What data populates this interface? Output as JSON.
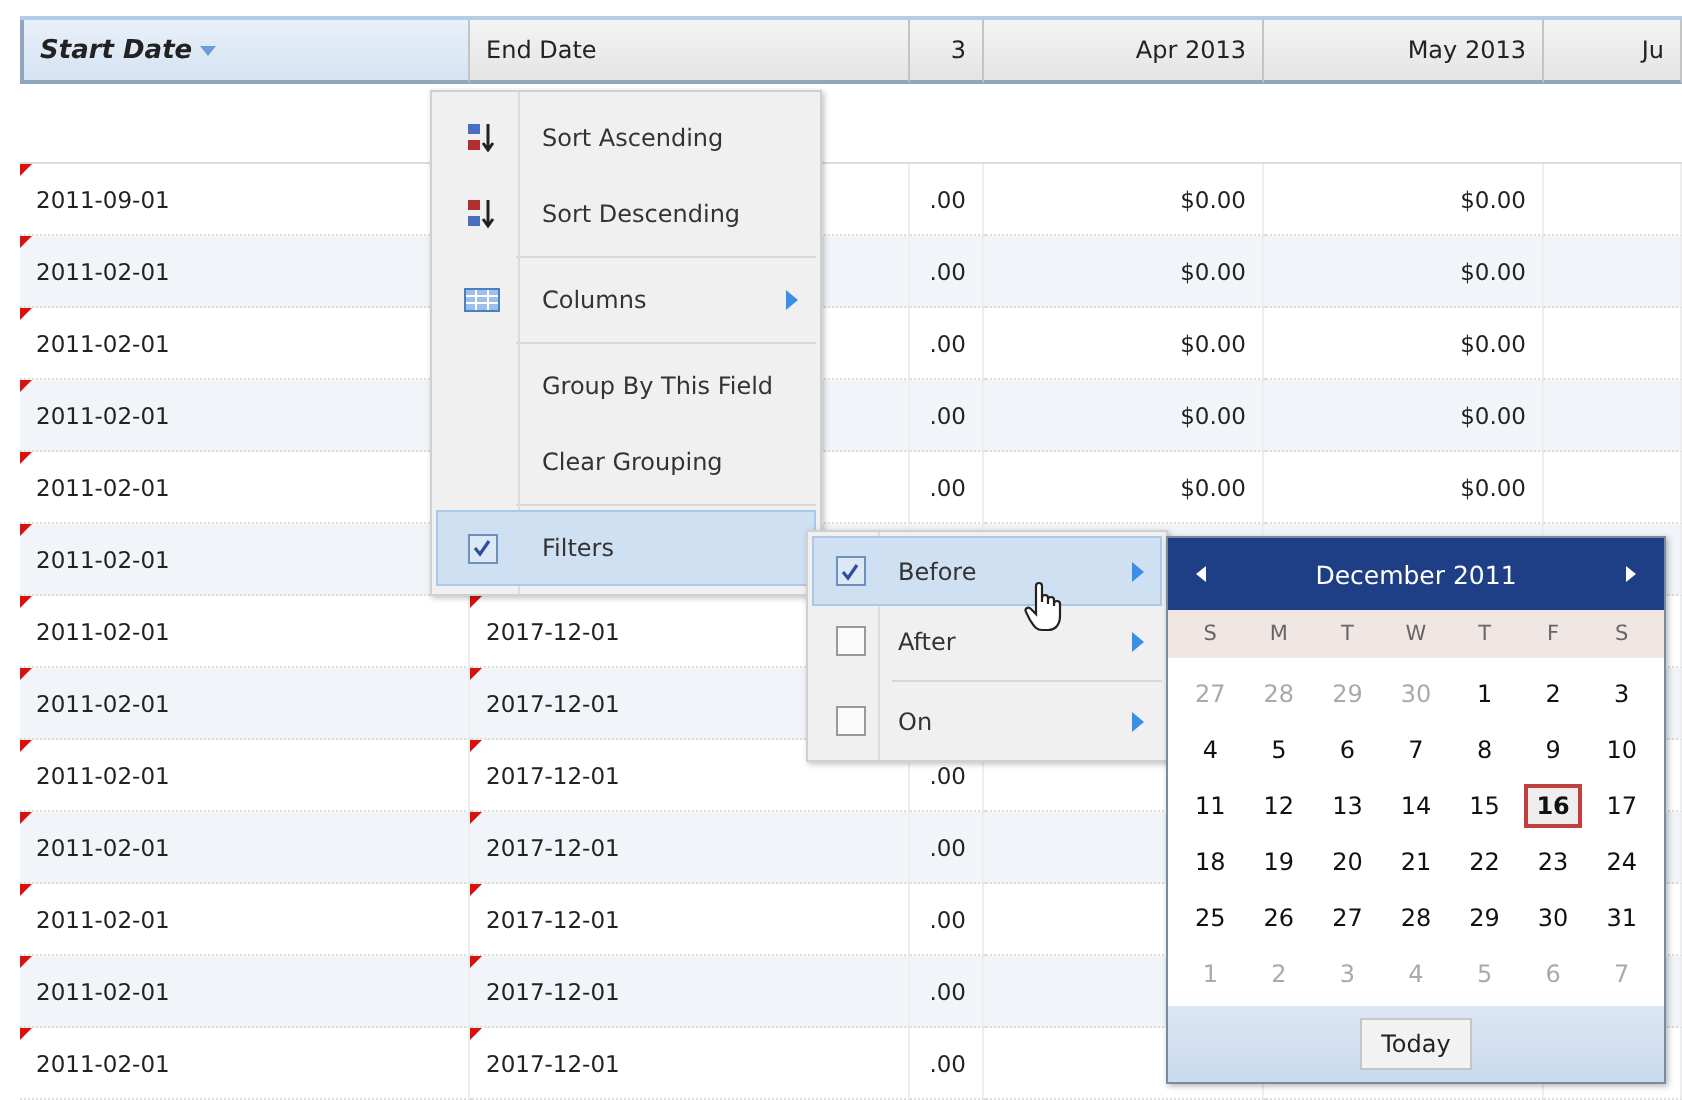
{
  "table": {
    "columns": [
      {
        "label": "Start Date",
        "active": true
      },
      {
        "label": "End Date",
        "active": false
      },
      {
        "label": "3",
        "active": false
      },
      {
        "label": "Apr 2013",
        "active": false
      },
      {
        "label": "May 2013",
        "active": false
      },
      {
        "label": "Ju",
        "active": false
      }
    ],
    "rows": [
      {
        "cells": [
          {
            "text": "2011-09-01",
            "modified": true
          },
          {
            "text": "",
            "modified": false
          },
          {
            "text": ".00",
            "modified": false
          },
          {
            "text": "$0.00",
            "modified": false
          },
          {
            "text": "$0.00",
            "modified": false
          },
          {
            "text": "",
            "modified": false
          }
        ]
      },
      {
        "cells": [
          {
            "text": "2011-02-01",
            "modified": true
          },
          {
            "text": "",
            "modified": false
          },
          {
            "text": ".00",
            "modified": false
          },
          {
            "text": "$0.00",
            "modified": false
          },
          {
            "text": "$0.00",
            "modified": false
          },
          {
            "text": "",
            "modified": false
          }
        ]
      },
      {
        "cells": [
          {
            "text": "2011-02-01",
            "modified": true
          },
          {
            "text": "",
            "modified": false
          },
          {
            "text": ".00",
            "modified": false
          },
          {
            "text": "$0.00",
            "modified": false
          },
          {
            "text": "$0.00",
            "modified": false
          },
          {
            "text": "",
            "modified": false
          }
        ]
      },
      {
        "cells": [
          {
            "text": "2011-02-01",
            "modified": true
          },
          {
            "text": "",
            "modified": false
          },
          {
            "text": ".00",
            "modified": false
          },
          {
            "text": "$0.00",
            "modified": false
          },
          {
            "text": "$0.00",
            "modified": false
          },
          {
            "text": "",
            "modified": false
          }
        ]
      },
      {
        "cells": [
          {
            "text": "2011-02-01",
            "modified": true
          },
          {
            "text": "",
            "modified": false
          },
          {
            "text": ".00",
            "modified": false
          },
          {
            "text": "$0.00",
            "modified": false
          },
          {
            "text": "$0.00",
            "modified": false
          },
          {
            "text": "",
            "modified": false
          }
        ]
      },
      {
        "cells": [
          {
            "text": "2011-02-01",
            "modified": true
          },
          null,
          null,
          {
            "text": "",
            "modified": false
          },
          {
            "text": "",
            "modified": false
          },
          {
            "text": "",
            "modified": false
          }
        ]
      },
      {
        "cells": [
          {
            "text": "2011-02-01",
            "modified": true
          },
          {
            "text": "2017-12-01",
            "modified": true
          },
          null,
          null,
          null,
          {
            "text": "",
            "modified": false
          }
        ]
      },
      {
        "cells": [
          {
            "text": "2011-02-01",
            "modified": true
          },
          {
            "text": "2017-12-01",
            "modified": true
          },
          null,
          null,
          null,
          {
            "text": "",
            "modified": false
          }
        ]
      },
      {
        "cells": [
          {
            "text": "2011-02-01",
            "modified": true
          },
          {
            "text": "2017-12-01",
            "modified": true
          },
          {
            "text": ".00",
            "modified": false
          },
          null,
          null,
          {
            "text": "",
            "modified": false
          }
        ]
      },
      {
        "cells": [
          {
            "text": "2011-02-01",
            "modified": true
          },
          {
            "text": "2017-12-01",
            "modified": true
          },
          {
            "text": ".00",
            "modified": false
          },
          {
            "text": "",
            "modified": false
          },
          null,
          {
            "text": "",
            "modified": false
          }
        ]
      },
      {
        "cells": [
          {
            "text": "2011-02-01",
            "modified": true
          },
          {
            "text": "2017-12-01",
            "modified": true
          },
          {
            "text": ".00",
            "modified": false
          },
          {
            "text": "",
            "modified": false
          },
          null,
          {
            "text": "",
            "modified": false
          }
        ]
      },
      {
        "cells": [
          {
            "text": "2011-02-01",
            "modified": true
          },
          {
            "text": "2017-12-01",
            "modified": true
          },
          {
            "text": ".00",
            "modified": false
          },
          {
            "text": "",
            "modified": false
          },
          null,
          {
            "text": "",
            "modified": false
          }
        ]
      },
      {
        "cells": [
          {
            "text": "2011-02-01",
            "modified": true
          },
          {
            "text": "2017-12-01",
            "modified": true
          },
          {
            "text": ".00",
            "modified": false
          },
          {
            "text": "",
            "modified": false
          },
          {
            "text": "",
            "modified": false
          },
          {
            "text": "",
            "modified": false
          }
        ]
      }
    ]
  },
  "column_menu": {
    "items": [
      {
        "kind": "sort-asc",
        "label": "Sort Ascending",
        "selected": false
      },
      {
        "kind": "sort-desc",
        "label": "Sort Descending",
        "selected": false
      },
      {
        "kind": "separator"
      },
      {
        "kind": "columns",
        "label": "Columns",
        "selected": false
      },
      {
        "kind": "separator"
      },
      {
        "kind": "plain",
        "label": "Group By This Field",
        "selected": false
      },
      {
        "kind": "plain",
        "label": "Clear Grouping",
        "selected": false
      },
      {
        "kind": "separator"
      },
      {
        "kind": "check",
        "label": "Filters",
        "checked": true,
        "selected": true
      }
    ]
  },
  "filter_menu": {
    "items": [
      {
        "kind": "check",
        "label": "Before",
        "checked": true,
        "selected": true
      },
      {
        "kind": "check",
        "label": "After",
        "checked": false,
        "selected": false
      },
      {
        "kind": "separator"
      },
      {
        "kind": "check",
        "label": "On",
        "checked": false,
        "selected": false
      }
    ]
  },
  "date_picker": {
    "title": "December 2011",
    "weekdays": [
      "S",
      "M",
      "T",
      "W",
      "T",
      "F",
      "S"
    ],
    "days": [
      {
        "label": "27",
        "other_month": true,
        "selected": false
      },
      {
        "label": "28",
        "other_month": true,
        "selected": false
      },
      {
        "label": "29",
        "other_month": true,
        "selected": false
      },
      {
        "label": "30",
        "other_month": true,
        "selected": false
      },
      {
        "label": "1",
        "other_month": false,
        "selected": false
      },
      {
        "label": "2",
        "other_month": false,
        "selected": false
      },
      {
        "label": "3",
        "other_month": false,
        "selected": false
      },
      {
        "label": "4",
        "other_month": false,
        "selected": false
      },
      {
        "label": "5",
        "other_month": false,
        "selected": false
      },
      {
        "label": "6",
        "other_month": false,
        "selected": false
      },
      {
        "label": "7",
        "other_month": false,
        "selected": false
      },
      {
        "label": "8",
        "other_month": false,
        "selected": false
      },
      {
        "label": "9",
        "other_month": false,
        "selected": false
      },
      {
        "label": "10",
        "other_month": false,
        "selected": false
      },
      {
        "label": "11",
        "other_month": false,
        "selected": false
      },
      {
        "label": "12",
        "other_month": false,
        "selected": false
      },
      {
        "label": "13",
        "other_month": false,
        "selected": false
      },
      {
        "label": "14",
        "other_month": false,
        "selected": false
      },
      {
        "label": "15",
        "other_month": false,
        "selected": false
      },
      {
        "label": "16",
        "other_month": false,
        "selected": true
      },
      {
        "label": "17",
        "other_month": false,
        "selected": false
      },
      {
        "label": "18",
        "other_month": false,
        "selected": false
      },
      {
        "label": "19",
        "other_month": false,
        "selected": false
      },
      {
        "label": "20",
        "other_month": false,
        "selected": false
      },
      {
        "label": "21",
        "other_month": false,
        "selected": false
      },
      {
        "label": "22",
        "other_month": false,
        "selected": false
      },
      {
        "label": "23",
        "other_month": false,
        "selected": false
      },
      {
        "label": "24",
        "other_month": false,
        "selected": false
      },
      {
        "label": "25",
        "other_month": false,
        "selected": false
      },
      {
        "label": "26",
        "other_month": false,
        "selected": false
      },
      {
        "label": "27",
        "other_month": false,
        "selected": false
      },
      {
        "label": "28",
        "other_month": false,
        "selected": false
      },
      {
        "label": "29",
        "other_month": false,
        "selected": false
      },
      {
        "label": "30",
        "other_month": false,
        "selected": false
      },
      {
        "label": "31",
        "other_month": false,
        "selected": false
      },
      {
        "label": "1",
        "other_month": true,
        "selected": false
      },
      {
        "label": "2",
        "other_month": true,
        "selected": false
      },
      {
        "label": "3",
        "other_month": true,
        "selected": false
      },
      {
        "label": "4",
        "other_month": true,
        "selected": false
      },
      {
        "label": "5",
        "other_month": true,
        "selected": false
      },
      {
        "label": "6",
        "other_month": true,
        "selected": false
      },
      {
        "label": "7",
        "other_month": true,
        "selected": false
      }
    ],
    "today_button": "Today"
  }
}
